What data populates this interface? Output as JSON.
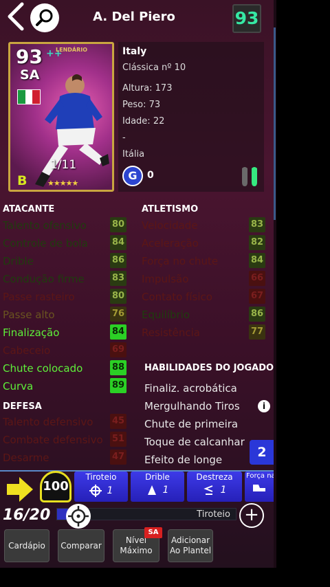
{
  "header": {
    "player_name": "A. Del Piero",
    "overall": "93"
  },
  "card": {
    "overall": "93",
    "position": "SA",
    "level": "1/11",
    "grade": "B",
    "stars": "★★★★★",
    "plus_icon": "++",
    "legend_text": "LENDÁRIO"
  },
  "info": {
    "nation": "Italy",
    "classic": "Clássica nº 10",
    "height": "Altura: 173",
    "weight": "Peso: 73",
    "age": "Idade: 22",
    "dash": "-",
    "nationality": "Itália",
    "g_label": "G",
    "g_value": "0"
  },
  "attack": {
    "title": "ATACANTE",
    "rows": [
      {
        "label": "Talento ofensivo",
        "value": "80"
      },
      {
        "label": "Controle de bola",
        "value": "84"
      },
      {
        "label": "Drible",
        "value": "86"
      },
      {
        "label": "Condução firme",
        "value": "83"
      },
      {
        "label": "Passe rasteiro",
        "value": "80"
      },
      {
        "label": "Passe alto",
        "value": "76"
      },
      {
        "label": "Finalização",
        "value": "84"
      },
      {
        "label": "Cabeceio",
        "value": "69"
      },
      {
        "label": "Chute colocado",
        "value": "88"
      },
      {
        "label": "Curva",
        "value": "89"
      }
    ]
  },
  "defense": {
    "title": "DEFESA",
    "rows": [
      {
        "label": "Talento defensivo",
        "value": "45"
      },
      {
        "label": "Combate defensivo",
        "value": "51"
      },
      {
        "label": "Desarme",
        "value": "47"
      }
    ]
  },
  "athletic": {
    "title": "ATLETISMO",
    "rows": [
      {
        "label": "Velocidade",
        "value": "83"
      },
      {
        "label": "Aceleração",
        "value": "82"
      },
      {
        "label": "Força no chute",
        "value": "84"
      },
      {
        "label": "Impulsão",
        "value": "66"
      },
      {
        "label": "Contato físico",
        "value": "67"
      },
      {
        "label": "Equilíbrio",
        "value": "86"
      },
      {
        "label": "Resistência",
        "value": "77"
      }
    ]
  },
  "skills": {
    "title": "HABILIDADES DO JOGADOR",
    "items": [
      "Finaliz. acrobática",
      "Mergulhando Tiros",
      "Chute de primeira",
      "Toque de calcanhar",
      "Efeito de longe"
    ],
    "more_count": "2",
    "info_icon": "i"
  },
  "training": {
    "gauge": "100",
    "buttons": [
      {
        "label": "Tiroteio",
        "value": "1",
        "icon": "target-icon"
      },
      {
        "label": "Drible",
        "value": "1",
        "icon": "dribble-icon"
      },
      {
        "label": "Destreza",
        "value": "1",
        "icon": "dexterity-icon"
      },
      {
        "label": "Força nas",
        "value": "",
        "icon": "boot-icon"
      }
    ],
    "fraction": "16/20",
    "progress_label": "Tiroteio",
    "progress_fraction": 0.06
  },
  "bottom": {
    "menu": "Cardápio",
    "compare": "Comparar",
    "max_level": "Nível Máximo",
    "max_badge": "SA",
    "add_squad": "Adicionar Ao Plantel"
  },
  "colors": {
    "accent_green": "#36e8a4",
    "stat_green": "#2bd025",
    "button_blue": "#2a37d8"
  }
}
